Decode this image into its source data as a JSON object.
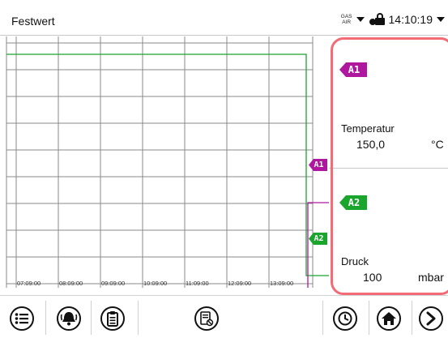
{
  "header": {
    "title": "Festwert",
    "gas_label": "GAS",
    "air_label": "AIR",
    "time": "14:10:19"
  },
  "chart": {
    "time_labels": [
      "07:09:00",
      "08:09:00",
      "09:09:00",
      "10:09:00",
      "11:09:00",
      "12:09:00",
      "13:09:00"
    ],
    "series_tags": [
      "A1",
      "A2"
    ],
    "colors": {
      "a1": "#b0179f",
      "a2": "#1aa52d",
      "grid": "#8a8a8a"
    }
  },
  "panel": {
    "a1": {
      "tag": "A1",
      "label": "Temperatur",
      "value": "150,0",
      "unit": "°C"
    },
    "a2": {
      "tag": "A2",
      "label": "Druck",
      "value": "100",
      "unit": "mbar"
    }
  },
  "toolbar": {
    "icons": [
      "menu-icon",
      "alarm-bell-icon",
      "clipboard-icon",
      "log-icon",
      "timer-icon",
      "home-icon",
      "next-icon"
    ]
  }
}
